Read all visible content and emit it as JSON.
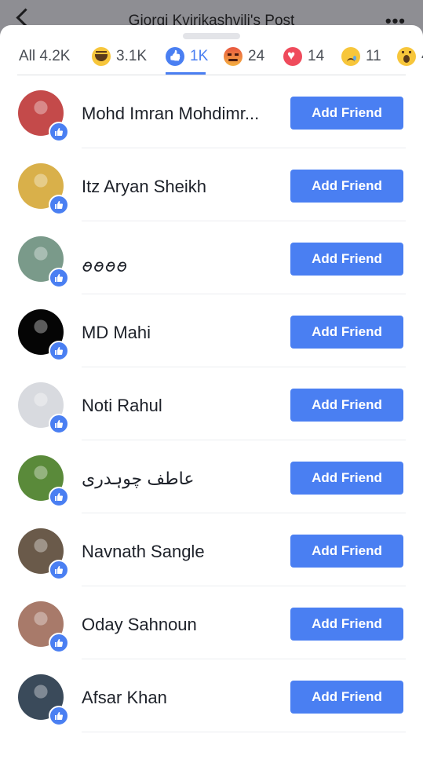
{
  "header": {
    "title": "Giorgi Kvirikashvili's Post"
  },
  "tabs": [
    {
      "label": "All 4.2K",
      "icon": "none"
    },
    {
      "label": "3.1K",
      "icon": "haha-icon"
    },
    {
      "label": "1K",
      "icon": "like-icon",
      "active": true
    },
    {
      "label": "24",
      "icon": "angry-icon"
    },
    {
      "label": "14",
      "icon": "love-icon"
    },
    {
      "label": "11",
      "icon": "sad-icon"
    },
    {
      "label": "4",
      "icon": "wow-icon"
    }
  ],
  "colors": {
    "accent": "#4a7ff2",
    "button_text": "#ffffff",
    "name_text": "#1d2129"
  },
  "people": [
    {
      "name": "Mohd Imran Mohdimr...",
      "button": "Add Friend",
      "avatar_color": "#c44a4a"
    },
    {
      "name": "Itz Aryan Sheikh",
      "button": "Add Friend",
      "avatar_color": "#d9b04a"
    },
    {
      "name": "ꪮꪮꪮꪮ",
      "button": "Add Friend",
      "avatar_color": "#7a9a8a"
    },
    {
      "name": "MD Mahi",
      "button": "Add Friend",
      "avatar_color": "#050505"
    },
    {
      "name": "Noti Rahul",
      "button": "Add Friend",
      "avatar_color": "#d8dadf"
    },
    {
      "name": "عاطف چوہدری",
      "button": "Add Friend",
      "avatar_color": "#5a8a3a"
    },
    {
      "name": "Navnath Sangle",
      "button": "Add Friend",
      "avatar_color": "#6a5a4a"
    },
    {
      "name": "Oday Sahnoun",
      "button": "Add Friend",
      "avatar_color": "#a87a6a"
    },
    {
      "name": "Afsar Khan",
      "button": "Add Friend",
      "avatar_color": "#3a4a5a"
    }
  ]
}
